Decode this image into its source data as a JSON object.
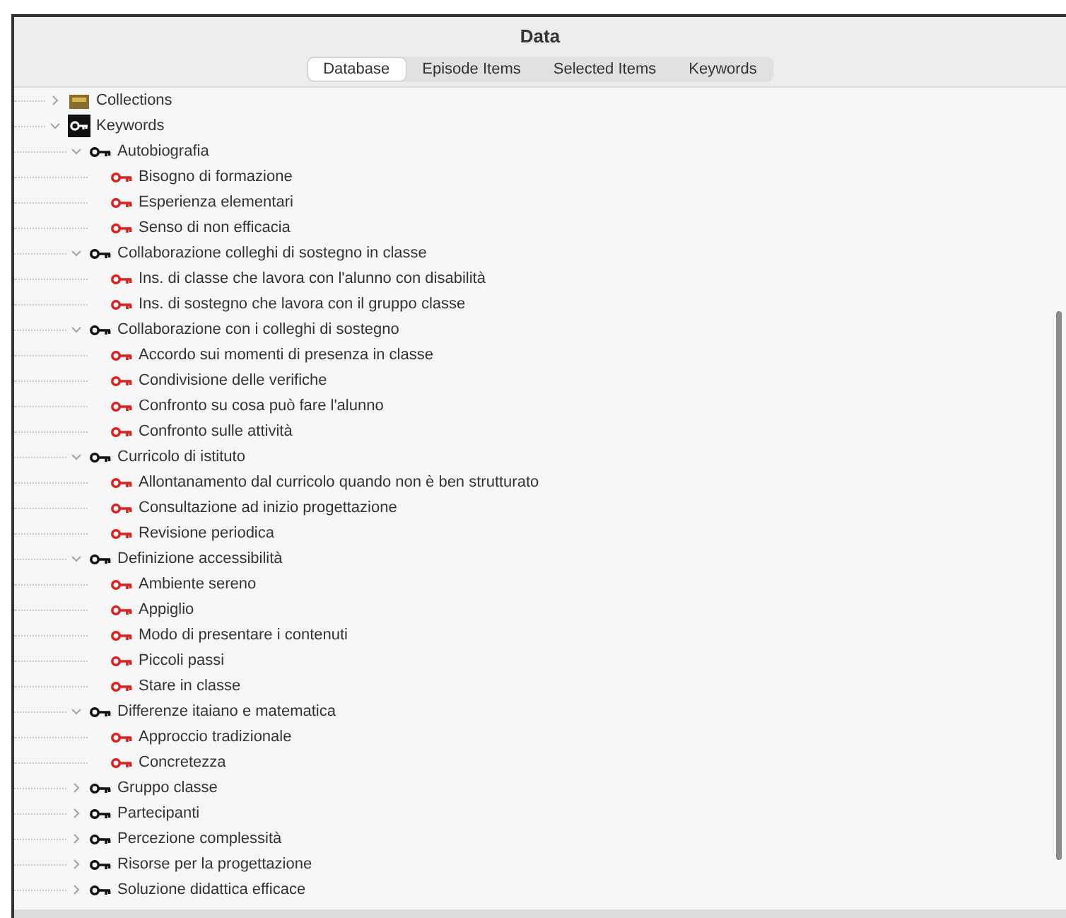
{
  "window": {
    "title": "Data"
  },
  "tabs": [
    {
      "label": "Database",
      "selected": true
    },
    {
      "label": "Episode Items",
      "selected": false
    },
    {
      "label": "Selected Items",
      "selected": false
    },
    {
      "label": "Keywords",
      "selected": false
    }
  ],
  "tree": [
    {
      "label": "Collections",
      "kind": "collection",
      "expanded": false
    },
    {
      "label": "Keywords",
      "kind": "keyword-root",
      "expanded": true,
      "children": [
        {
          "label": "Autobiografia",
          "kind": "keyword-group",
          "expanded": true,
          "children": [
            {
              "label": "Bisogno di formazione",
              "kind": "keyword"
            },
            {
              "label": "Esperienza elementari",
              "kind": "keyword"
            },
            {
              "label": "Senso di non efficacia",
              "kind": "keyword"
            }
          ]
        },
        {
          "label": "Collaborazione colleghi di sostegno in classe",
          "kind": "keyword-group",
          "expanded": true,
          "children": [
            {
              "label": "Ins. di classe che lavora con l'alunno con disabilità",
              "kind": "keyword"
            },
            {
              "label": "Ins. di sostegno che lavora con il gruppo classe",
              "kind": "keyword"
            }
          ]
        },
        {
          "label": "Collaborazione con i colleghi di sostegno",
          "kind": "keyword-group",
          "expanded": true,
          "children": [
            {
              "label": "Accordo sui momenti di presenza in classe",
              "kind": "keyword"
            },
            {
              "label": "Condivisione delle verifiche",
              "kind": "keyword"
            },
            {
              "label": "Confronto su cosa può fare l'alunno",
              "kind": "keyword"
            },
            {
              "label": "Confronto sulle attività",
              "kind": "keyword"
            }
          ]
        },
        {
          "label": "Curricolo di istituto",
          "kind": "keyword-group",
          "expanded": true,
          "children": [
            {
              "label": "Allontanamento dal curricolo quando non è ben strutturato",
              "kind": "keyword"
            },
            {
              "label": "Consultazione ad inizio progettazione",
              "kind": "keyword"
            },
            {
              "label": "Revisione periodica",
              "kind": "keyword"
            }
          ]
        },
        {
          "label": "Definizione accessibilità",
          "kind": "keyword-group",
          "expanded": true,
          "children": [
            {
              "label": "Ambiente sereno",
              "kind": "keyword"
            },
            {
              "label": "Appiglio",
              "kind": "keyword"
            },
            {
              "label": "Modo di presentare i contenuti",
              "kind": "keyword"
            },
            {
              "label": "Piccoli passi",
              "kind": "keyword"
            },
            {
              "label": "Stare in classe",
              "kind": "keyword"
            }
          ]
        },
        {
          "label": "Differenze itaiano e matematica",
          "kind": "keyword-group",
          "expanded": true,
          "children": [
            {
              "label": "Approccio tradizionale",
              "kind": "keyword"
            },
            {
              "label": "Concretezza",
              "kind": "keyword"
            }
          ]
        },
        {
          "label": "Gruppo classe",
          "kind": "keyword-group",
          "expanded": false
        },
        {
          "label": "Partecipanti",
          "kind": "keyword-group",
          "expanded": false
        },
        {
          "label": "Percezione complessità",
          "kind": "keyword-group",
          "expanded": false
        },
        {
          "label": "Risorse per la progettazione",
          "kind": "keyword-group",
          "expanded": false
        },
        {
          "label": "Soluzione didattica efficace",
          "kind": "keyword-group",
          "expanded": false
        }
      ]
    }
  ]
}
